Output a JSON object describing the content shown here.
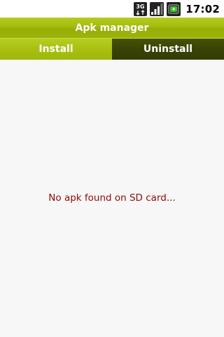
{
  "status_bar": {
    "time": "17:02",
    "network_label": "3G",
    "icons": [
      "network-3g-icon",
      "signal-strength-icon",
      "battery-charging-icon"
    ]
  },
  "app": {
    "title": "Apk manager"
  },
  "tabs": [
    {
      "label": "Install",
      "selected": true
    },
    {
      "label": "Uninstall",
      "selected": false
    }
  ],
  "content": {
    "empty_message": "No apk found on SD card..."
  },
  "colors": {
    "accent": "#a4bb0e",
    "tab_inactive": "#3a4306",
    "message": "#8b0b0b",
    "background": "#f7f7f7"
  }
}
